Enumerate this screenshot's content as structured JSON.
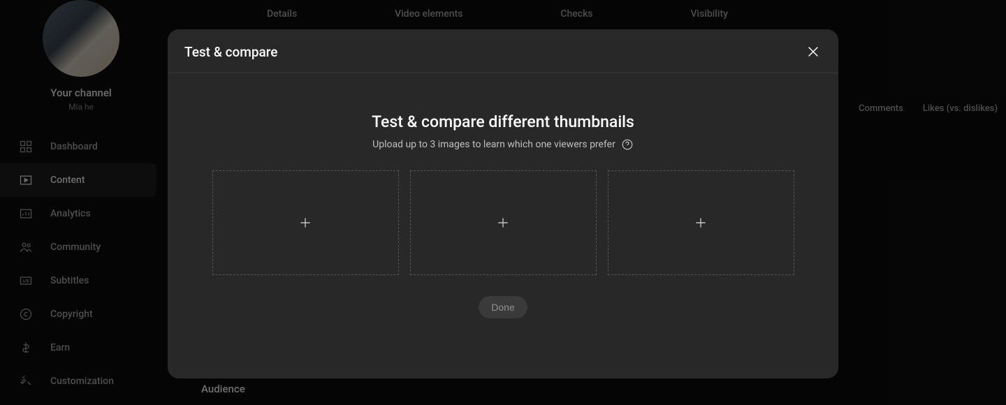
{
  "sidebar": {
    "channel_title": "Your channel",
    "channel_name": "Mia he",
    "items": [
      {
        "id": "dashboard",
        "label": "Dashboard",
        "icon": "dashboard-icon",
        "active": false
      },
      {
        "id": "content",
        "label": "Content",
        "icon": "content-icon",
        "active": true
      },
      {
        "id": "analytics",
        "label": "Analytics",
        "icon": "analytics-icon",
        "active": false
      },
      {
        "id": "community",
        "label": "Community",
        "icon": "community-icon",
        "active": false
      },
      {
        "id": "subtitles",
        "label": "Subtitles",
        "icon": "subtitles-icon",
        "active": false
      },
      {
        "id": "copyright",
        "label": "Copyright",
        "icon": "copyright-icon",
        "active": false
      },
      {
        "id": "earn",
        "label": "Earn",
        "icon": "earn-icon",
        "active": false
      },
      {
        "id": "customization",
        "label": "Customization",
        "icon": "customization-icon",
        "active": false
      }
    ]
  },
  "steps": {
    "details": "Details",
    "video_elements": "Video elements",
    "checks": "Checks",
    "visibility": "Visibility"
  },
  "columns": {
    "comments": "Comments",
    "likes": "Likes (vs. dislikes)"
  },
  "section": {
    "audience": "Audience"
  },
  "modal": {
    "title": "Test & compare",
    "body_title": "Test & compare different thumbnails",
    "body_sub": "Upload up to 3 images to learn which one viewers prefer",
    "done_label": "Done"
  }
}
